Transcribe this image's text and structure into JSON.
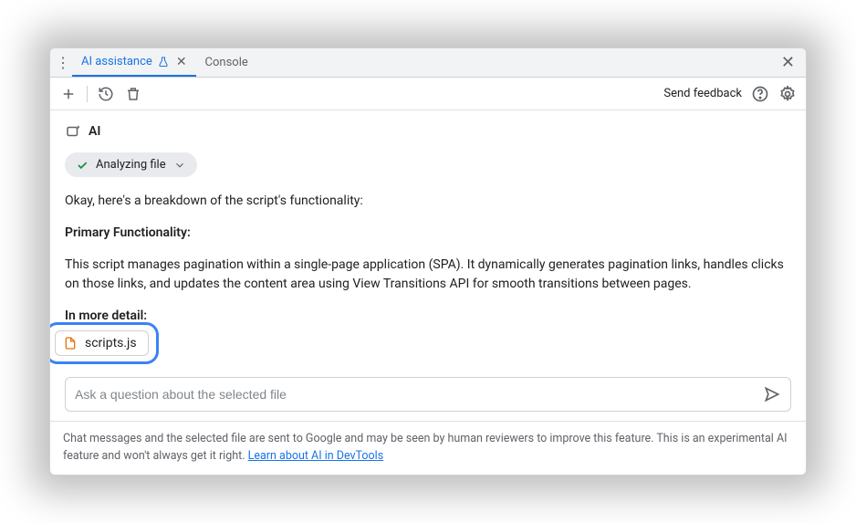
{
  "tabs": {
    "ai": "AI assistance",
    "console": "Console"
  },
  "toolbar": {
    "feedback": "Send feedback"
  },
  "ai": {
    "label": "AI",
    "status": "Analyzing file"
  },
  "message": {
    "intro": "Okay, here's a breakdown of the script's functionality:",
    "h1": "Primary Functionality:",
    "p1": "This script manages pagination within a single-page application (SPA). It dynamically generates pagination links, handles clicks on those links, and updates the content area using View Transitions API for smooth transitions between pages.",
    "h2": "In more detail:"
  },
  "file": {
    "name": "scripts.js"
  },
  "input": {
    "placeholder": "Ask a question about the selected file"
  },
  "footer": {
    "text": "Chat messages and the selected file are sent to Google and may be seen by human reviewers to improve this feature. This is an experimental AI feature and won't always get it right. ",
    "link": "Learn about AI in DevTools"
  }
}
